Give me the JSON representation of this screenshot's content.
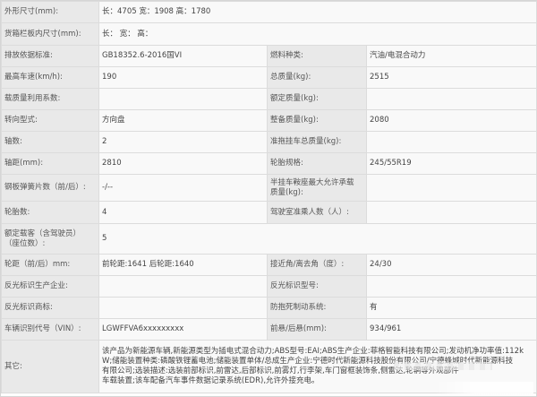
{
  "rows": {
    "dimensions": {
      "label": "外形尺寸(mm):",
      "value": "长：4705 宽：1908 高：1780"
    },
    "cargo": {
      "label": "货箱栏板内尺寸(mm):",
      "value": "长： 宽： 高："
    },
    "emission": {
      "label": "排放依据标准:",
      "value": "GB18352.6-2016国VI",
      "label2": "燃料种类:",
      "value2": "汽油/电混合动力"
    },
    "speed": {
      "label": "最高车速(km/h):",
      "value": "190",
      "label2": "总质量(kg):",
      "value2": "2515"
    },
    "load_util": {
      "label": "载质量利用系数:",
      "value": "",
      "label2": "额定质量(kg):",
      "value2": ""
    },
    "steering": {
      "label": "转向型式:",
      "value": "方向盘",
      "label2": "整备质量(kg):",
      "value2": "2080"
    },
    "axles": {
      "label": "轴数:",
      "value": "2",
      "label2": "准拖挂车总质量(kg):",
      "value2": ""
    },
    "wheelbase": {
      "label": "轴距(mm):",
      "value": "2810",
      "label2": "轮胎规格:",
      "value2": "245/55R19"
    },
    "springs": {
      "label": "钢板弹簧片数（前/后）:",
      "value": "-/--",
      "label2_lines": [
        "半挂车鞍座最大允许承载",
        "质量(kg):"
      ],
      "value2": ""
    },
    "tires": {
      "label": "轮胎数:",
      "value": "4",
      "label2": "驾驶室准乘人数（人）:",
      "value2": ""
    },
    "seats": {
      "label_lines": [
        "额定载客（含驾驶员）",
        "（座位数）:"
      ],
      "value": "5"
    },
    "track": {
      "label": "轮距（前/后）mm:",
      "value": "前轮距:1641 后轮距:1640",
      "label2": "接近角/离去角（度）:",
      "value2": "24/30"
    },
    "reflector_co": {
      "label": "反光标识生产企业:",
      "value": "",
      "label2": "反光标识型号:",
      "value2": ""
    },
    "reflector_brand": {
      "label": "反光标识商标:",
      "value": "",
      "label2": "防抱死制动系统:",
      "value2": "有"
    },
    "vin": {
      "label": "车辆识别代号（VIN）:",
      "value": "LGWFFVA6xxxxxxxxx",
      "label2": "前悬/后悬(mm):",
      "value2": "934/961"
    },
    "other": {
      "label": "其它:",
      "lines": [
        "该产品为新能源车辆,新能源类型为插电式混合动力;ABS型号:EAI;ABS生产企业:菲格智能科技有限公司;发动机净功率值:112k",
        "W;储能装置种类:磷酸铁锂蓄电池;储能装置单体/总成生产企业:宁德时代新能源科技股份有限公司/宁德蜂城时代新能源科技",
        "有限公司;选装描述:选装前部标识,前雷达,后部标识,前雾灯,行李架,车门窗框装饰条,侧雷达,轮辋等外观部件",
        "车载装置;该车配备汽车事件数据记录系统(EDR),允许外接充电。"
      ]
    }
  }
}
